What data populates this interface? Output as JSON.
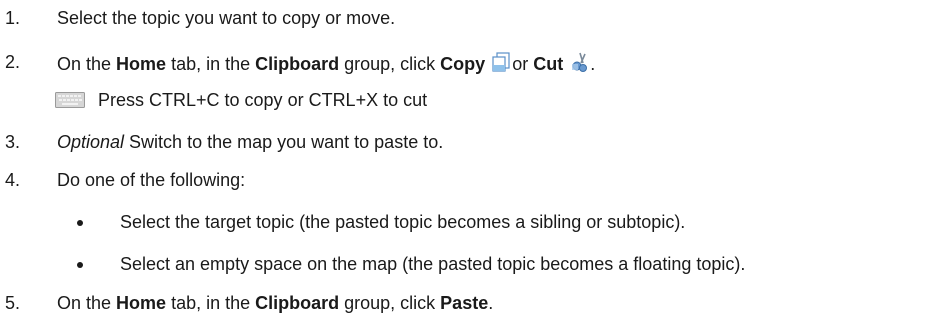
{
  "steps": [
    {
      "num": "1.",
      "text": "Select the topic you want to copy or move."
    },
    {
      "num": "2.",
      "pre": "On the ",
      "home": "Home",
      "mid1": " tab, in the ",
      "clipboard": "Clipboard",
      "mid2": " group, click ",
      "copy": "Copy",
      "or": "or ",
      "cut": "Cut",
      "end": "."
    },
    {
      "num": "3.",
      "optional": "Optional",
      "text": " Switch to the map you want to paste to."
    },
    {
      "num": "4.",
      "text": "Do one of the following:"
    },
    {
      "num": "5.",
      "pre": "On the ",
      "home": "Home",
      "mid1": " tab, in the ",
      "clipboard": "Clipboard",
      "mid2": " group, click ",
      "paste": "Paste",
      "end": "."
    }
  ],
  "shortcut_tip": "Press CTRL+C to copy or CTRL+X to cut",
  "bullets": [
    "Select the target topic (the pasted topic becomes a sibling or subtopic).",
    "Select an empty space on the map (the pasted topic becomes a floating topic)."
  ],
  "icons": {
    "copy": "copy-icon",
    "cut": "cut-icon",
    "keyboard": "keyboard-icon"
  }
}
